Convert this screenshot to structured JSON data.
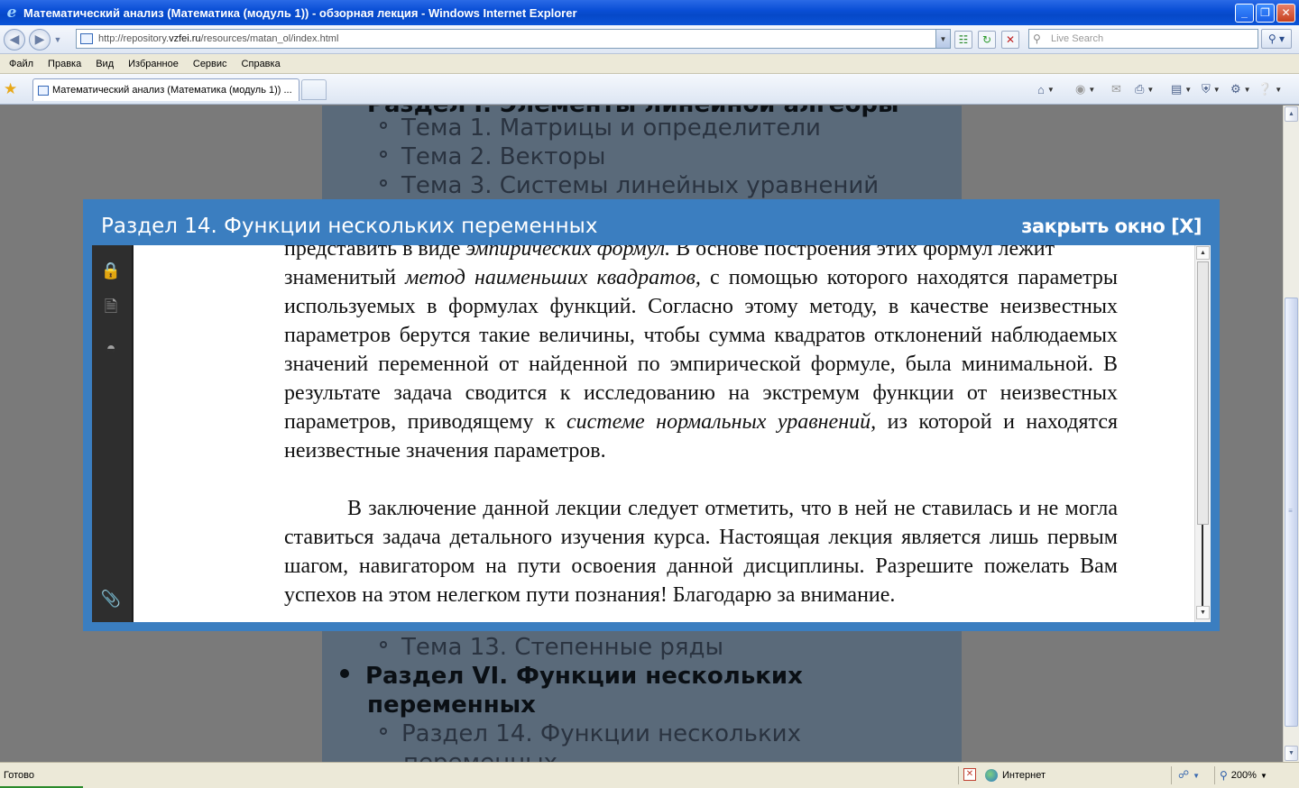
{
  "window": {
    "title": "Математический анализ (Математика (модуль 1)) - обзорная лекция - Windows Internet Explorer",
    "app_icon": "ie-icon",
    "buttons": {
      "minimize": "_",
      "maximize": "❐",
      "close": "✕"
    }
  },
  "address_bar": {
    "url_prefix": "http://repository.",
    "url_host": "vzfei.ru",
    "url_path": "/resources/matan_ol/index.html",
    "search_placeholder": "Live Search"
  },
  "menu": [
    "Файл",
    "Правка",
    "Вид",
    "Избранное",
    "Сервис",
    "Справка"
  ],
  "tab": {
    "label": "Математический анализ (Математика (модуль 1)) ..."
  },
  "page": {
    "top_fragment": "Раздел I. Элементы линейной алгебры",
    "items": [
      "Тема 1. Матрицы и определители",
      "Тема 2. Векторы",
      "Тема 3. Системы линейных уравнений",
      "Тема 13. Степенные ряды"
    ],
    "section_vi_line1": "Раздел VI. Функции нескольких",
    "section_vi_line2": "переменных",
    "sub_item_line1": "Раздел 14. Функции нескольких",
    "sub_item_line2": "переменных"
  },
  "modal": {
    "title": "Раздел 14. Функции нескольких переменных",
    "close_label": "закрыть окно [X]"
  },
  "doc": {
    "line0_a": "представить в виде ",
    "line0_i": "эмпирических формул.",
    "line0_b": " В основе построения этих формул лежит",
    "p1_a": "знаменитый ",
    "p1_i1": "метод наименьших квадратов,",
    "p1_b": " с помощью которого находятся параметры используемых в формулах функций. Согласно этому методу, в качестве неизвестных параметров берутся такие величины, чтобы сумма квадратов отклонений наблюдаемых значений переменной от найденной по эмпирической формуле, была минимальной. В результате задача сводится к исследованию на экстремум функции от неизвестных параметров, приводящему к ",
    "p1_i2": "системе нормальных уравнений,",
    "p1_c": " из которой и находятся неизвестные значения параметров.",
    "p2": "В заключение данной лекции следует отметить, что в ней не ставилась и не могла ставиться задача детального изучения курса. Настоящая лекция является лишь первым шагом, навигатором на пути освоения данной дисциплины. Разрешите пожелать Вам успехов на этом нелегком пути познания! Благодарю за внимание."
  },
  "status": {
    "text": "Готово",
    "zone": "Интернет",
    "zoom": "200%"
  }
}
